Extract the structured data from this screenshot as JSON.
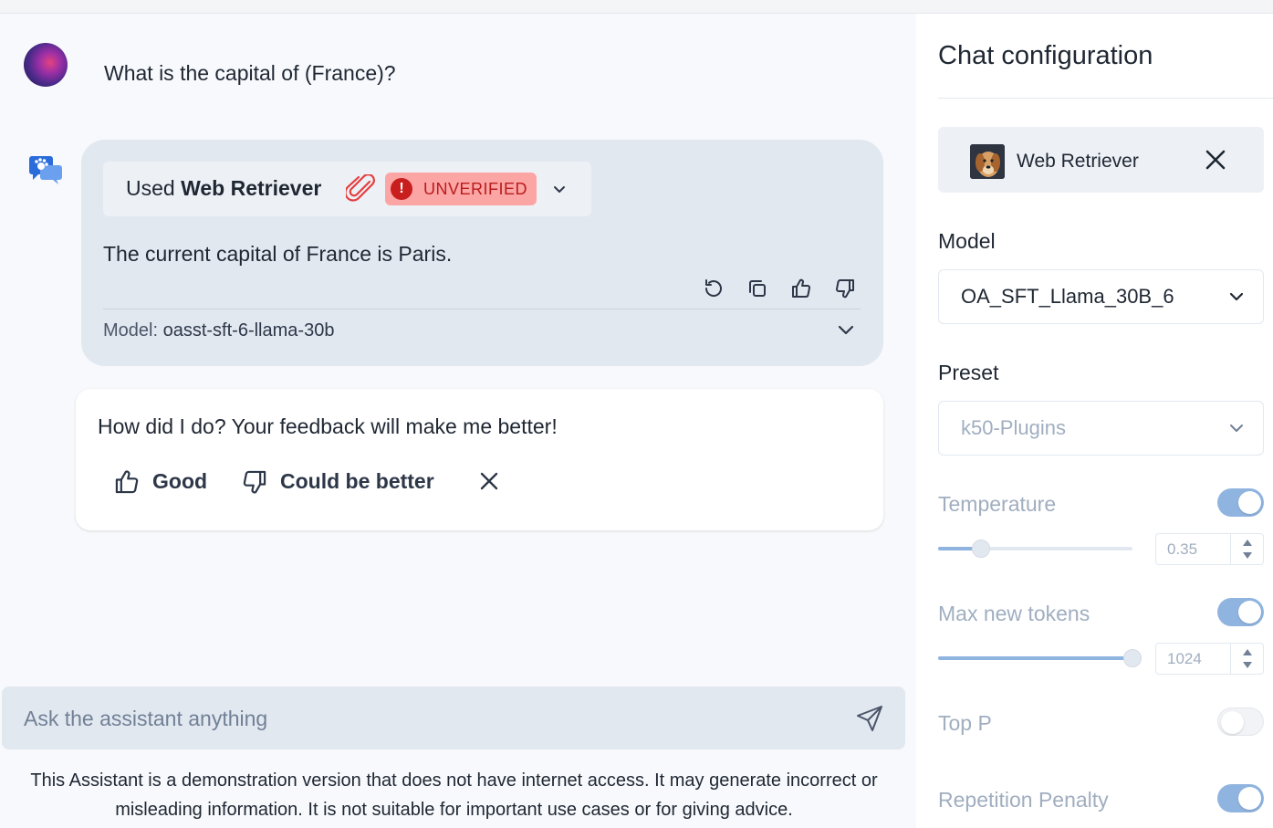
{
  "chat": {
    "user_message": "What is the capital of (France)?",
    "assistant": {
      "plugin_prefix": "Used",
      "plugin_name": "Web Retriever",
      "badge": "UNVERIFIED",
      "badge_symbol": "!",
      "answer": "The current capital of France is Paris.",
      "model_label": "Model:",
      "model_value": "oasst-sft-6-llama-30b"
    },
    "feedback": {
      "question": "How did I do? Your feedback will make me better!",
      "good_label": "Good",
      "better_label": "Could be better"
    },
    "input_placeholder": "Ask the assistant anything",
    "disclaimer": "This Assistant is a demonstration version that does not have internet access. It may generate incorrect or misleading information. It is not suitable for important use cases or for giving advice."
  },
  "config": {
    "title": "Chat configuration",
    "plugin_name": "Web Retriever",
    "model_label": "Model",
    "model_value": "OA_SFT_Llama_30B_6",
    "preset_label": "Preset",
    "preset_value": "k50-Plugins",
    "temperature": {
      "label": "Temperature",
      "value": "0.35",
      "enabled": true,
      "level": 0.18
    },
    "max_new_tokens": {
      "label": "Max new tokens",
      "value": "1024",
      "enabled": true,
      "level": 1.0
    },
    "top_p": {
      "label": "Top P",
      "enabled": false
    },
    "repetition_penalty": {
      "label": "Repetition Penalty",
      "enabled": true
    }
  },
  "colors": {
    "accent_toggle": "#90b4e0",
    "badge_bg": "#fca5a5",
    "badge_text": "#b91c1c",
    "bubble_bg": "#e2e8f0",
    "bot_icon": "#2b6cdb"
  }
}
